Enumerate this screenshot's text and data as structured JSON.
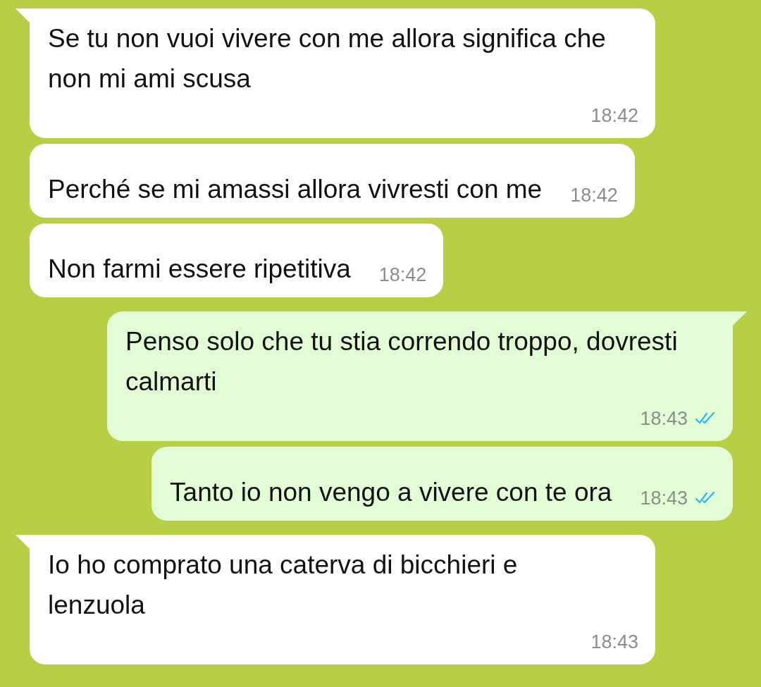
{
  "messages": [
    {
      "kind": "incoming",
      "tail": true,
      "text": "Se tu non vuoi vivere con me allora significa che non mi ami scusa",
      "time": "18:42"
    },
    {
      "kind": "incoming",
      "tail": false,
      "text": "Perché se mi amassi allora vivresti con me",
      "time": "18:42"
    },
    {
      "kind": "incoming",
      "tail": false,
      "text": "Non farmi essere ripetitiva",
      "time": "18:42"
    },
    {
      "kind": "outgoing",
      "tail": true,
      "text": "Penso solo che tu stia correndo troppo, dovresti calmarti",
      "time": "18:43",
      "read": true
    },
    {
      "kind": "outgoing",
      "tail": false,
      "text": "Tanto io non vengo a vivere con te ora",
      "time": "18:43",
      "read": true
    },
    {
      "kind": "incoming",
      "tail": true,
      "text": "Io ho comprato una caterva di bicchieri e lenzuola",
      "time": "18:43"
    }
  ]
}
